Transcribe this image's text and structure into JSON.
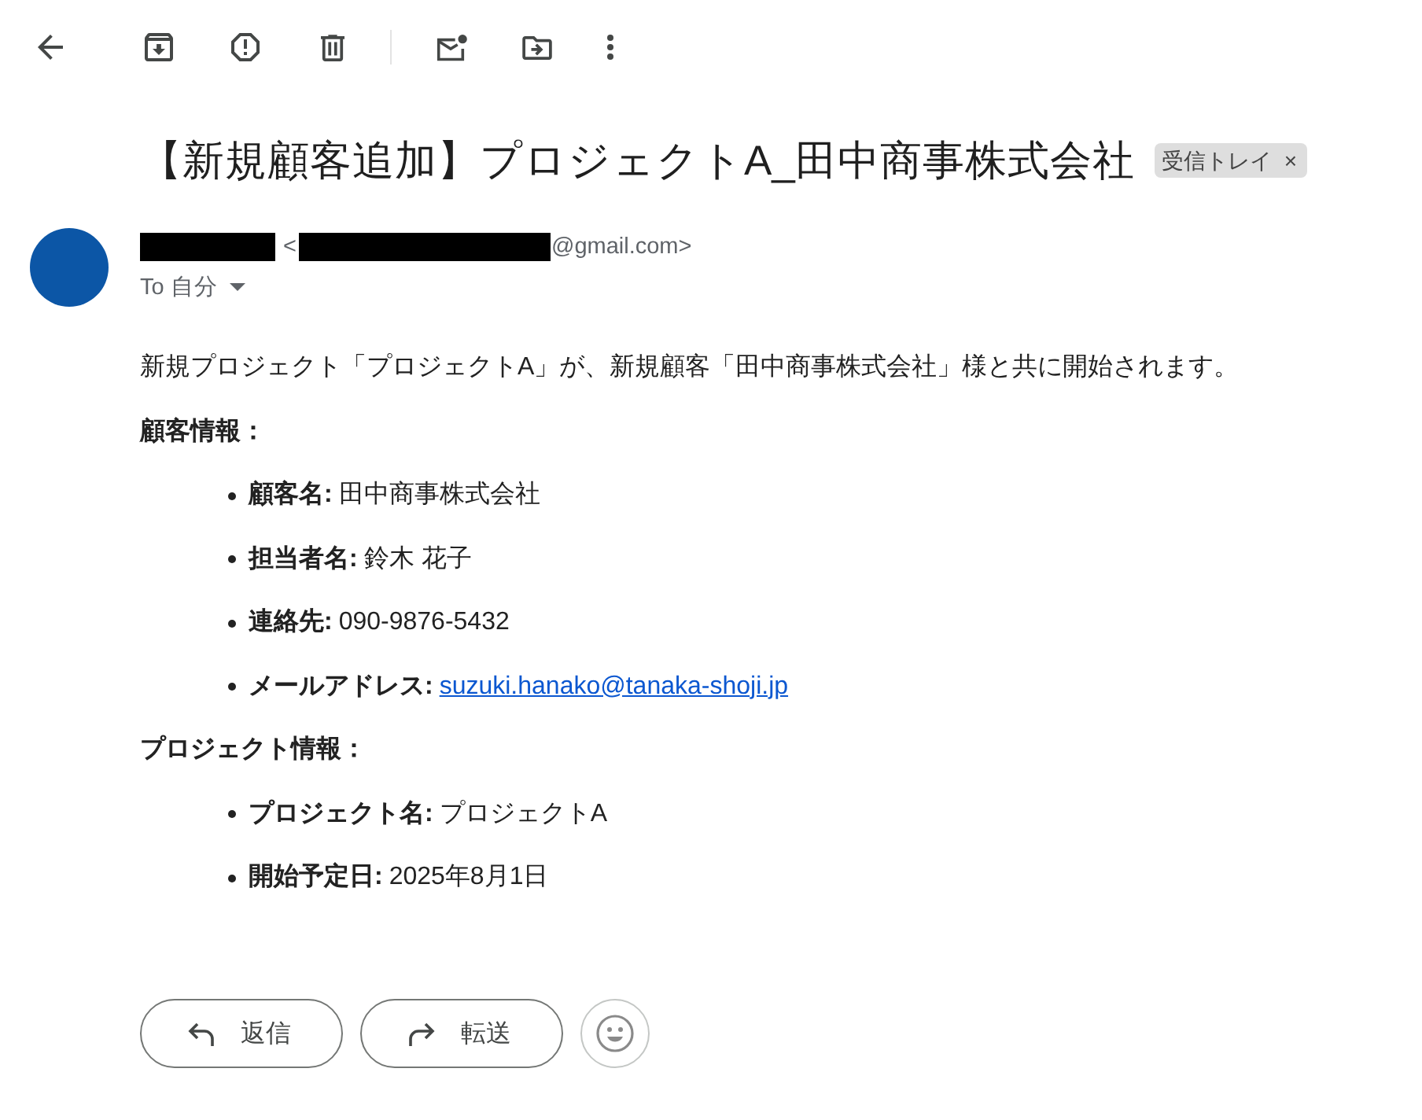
{
  "toolbar": [
    {
      "kind": "back"
    },
    {
      "kind": "archive"
    },
    {
      "kind": "report"
    },
    {
      "kind": "delete"
    },
    {
      "kind": "divider"
    },
    {
      "kind": "mark_unread"
    },
    {
      "kind": "move"
    },
    {
      "kind": "more"
    }
  ],
  "subject": "【新規顧客追加】プロジェクトA_田中商事株式会社",
  "labels": [
    {
      "name": "受信トレイ",
      "remove": "×"
    }
  ],
  "sender": {
    "name_redacted": true,
    "address_open": "<",
    "address_redacted": true,
    "address_suffix": "@gmail.com>"
  },
  "recipient": {
    "text": "To 自分",
    "expanded": false
  },
  "body": {
    "intro": "新規プロジェクト「プロジェクトA」が、新規顧客「田中商事株式会社」様と共に開始されます。",
    "sections": [
      {
        "heading": "顧客情報：",
        "items": [
          {
            "kind": "text",
            "label": "顧客名:",
            "value": "田中商事株式会社"
          },
          {
            "kind": "text",
            "label": "担当者名:",
            "value": "鈴木 花子"
          },
          {
            "kind": "text",
            "label": "連絡先:",
            "value": "090-9876-5432"
          },
          {
            "kind": "link",
            "label": "メールアドレス:",
            "value": "suzuki.hanako@tanaka-shoji.jp"
          }
        ]
      },
      {
        "heading": "プロジェクト情報：",
        "items": [
          {
            "kind": "text",
            "label": "プロジェクト名:",
            "value": "プロジェクトA"
          },
          {
            "kind": "text",
            "label": "開始予定日:",
            "value": "2025年8月1日"
          }
        ]
      }
    ]
  },
  "actions": [
    {
      "kind": "reply",
      "label": "返信"
    },
    {
      "kind": "forward",
      "label": "転送"
    },
    {
      "kind": "emoji"
    }
  ]
}
